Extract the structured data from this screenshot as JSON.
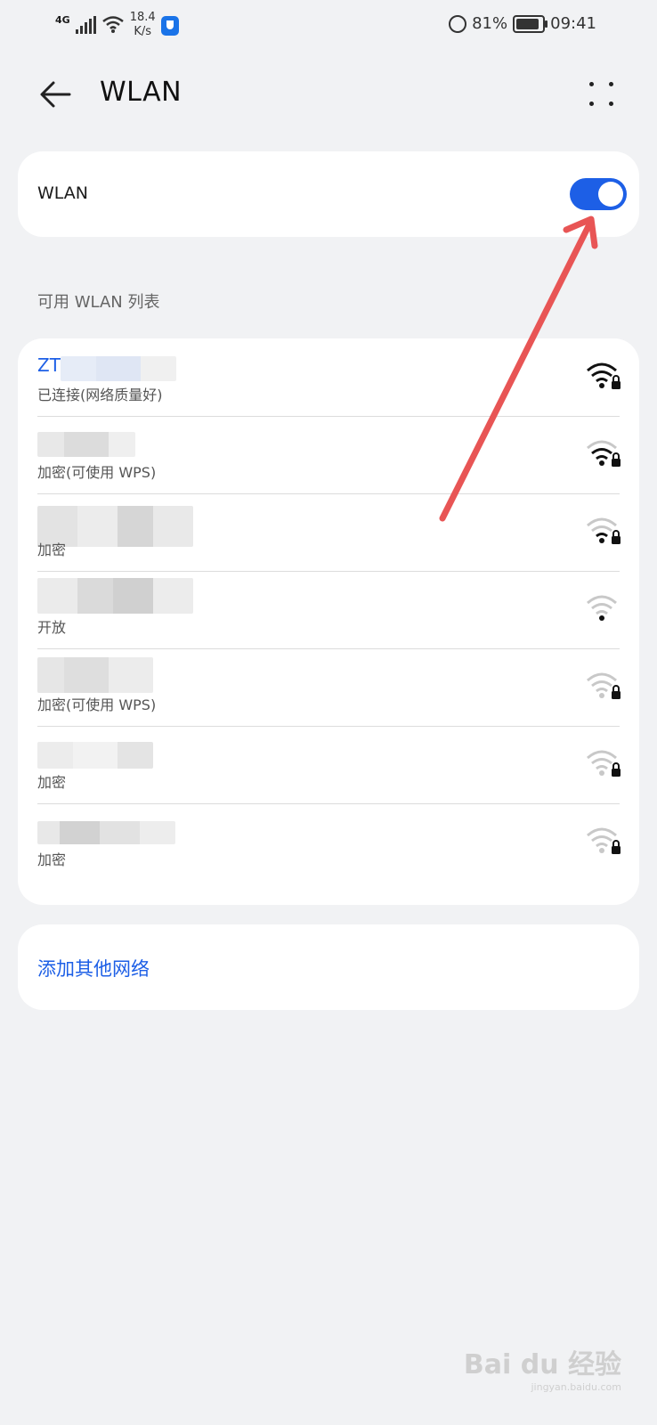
{
  "status_bar": {
    "network": "4G",
    "speed_value": "18.4",
    "speed_unit": "K/s",
    "battery": "81%",
    "time": "09:41"
  },
  "header": {
    "title": "WLAN"
  },
  "wlan_toggle": {
    "label": "WLAN",
    "enabled": true,
    "color": "#1d5fe6"
  },
  "available_list": {
    "title": "可用 WLAN 列表",
    "networks": [
      {
        "name": "ZT",
        "status": "已连接(网络质量好)",
        "signal_level": 4,
        "secured": true,
        "connected": true
      },
      {
        "name": "",
        "status": "加密(可使用 WPS)",
        "signal_level": 3,
        "secured": true,
        "connected": false
      },
      {
        "name": "",
        "status": "加密",
        "signal_level": 2,
        "secured": true,
        "connected": false
      },
      {
        "name": "",
        "status": "开放",
        "signal_level": 2,
        "secured": false,
        "connected": false
      },
      {
        "name": "",
        "status": "加密(可使用 WPS)",
        "signal_level": 1,
        "secured": true,
        "connected": false
      },
      {
        "name": "",
        "status": "加密",
        "signal_level": 1,
        "secured": true,
        "connected": false
      },
      {
        "name": "",
        "status": "加密",
        "signal_level": 1,
        "secured": true,
        "connected": false
      }
    ]
  },
  "add_network": {
    "label": "添加其他网络"
  },
  "watermark": {
    "brand": "Bai du 经验",
    "site": "jingyan.baidu.com"
  }
}
